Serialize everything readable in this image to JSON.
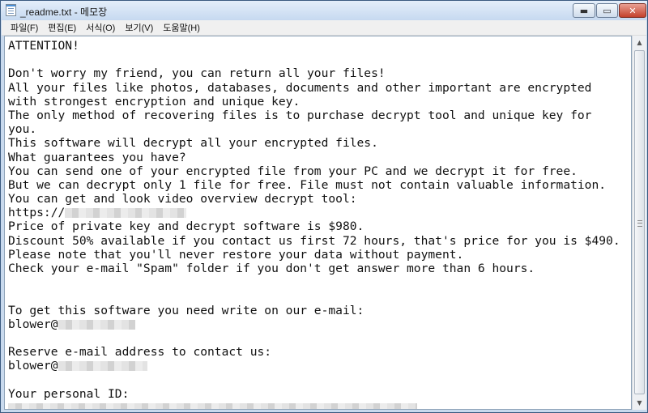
{
  "window": {
    "title": "_readme.txt - 메모장",
    "controls": {
      "minimize": "▬",
      "maximize": "▭",
      "close": "✕"
    }
  },
  "menu": [
    "파일(F)",
    "편집(E)",
    "서식(O)",
    "보기(V)",
    "도움말(H)"
  ],
  "document": {
    "lines": [
      "ATTENTION!",
      "",
      "Don't worry my friend, you can return all your files!",
      "All your files like photos, databases, documents and other important are encrypted",
      "with strongest encryption and unique key.",
      "The only method of recovering files is to purchase decrypt tool and unique key for",
      "you.",
      "This software will decrypt all your encrypted files.",
      "What guarantees you have?",
      "You can send one of your encrypted file from your PC and we decrypt it for free.",
      "But we can decrypt only 1 file for free. File must not contain valuable information.",
      "You can get and look video overview decrypt tool:",
      "https://",
      "Price of private key and decrypt software is $980.",
      "Discount 50% available if you contact us first 72 hours, that's price for you is $490.",
      "Please note that you'll never restore your data without payment.",
      "Check your e-mail \"Spam\" folder if you don't get answer more than 6 hours.",
      "",
      "",
      "To get this software you need write on our e-mail:",
      "blower@",
      "",
      "Reserve e-mail address to contact us:",
      "blower@",
      "",
      "Your personal ID:",
      ""
    ]
  },
  "scrollbar": {
    "up": "▲",
    "down": "▼"
  }
}
